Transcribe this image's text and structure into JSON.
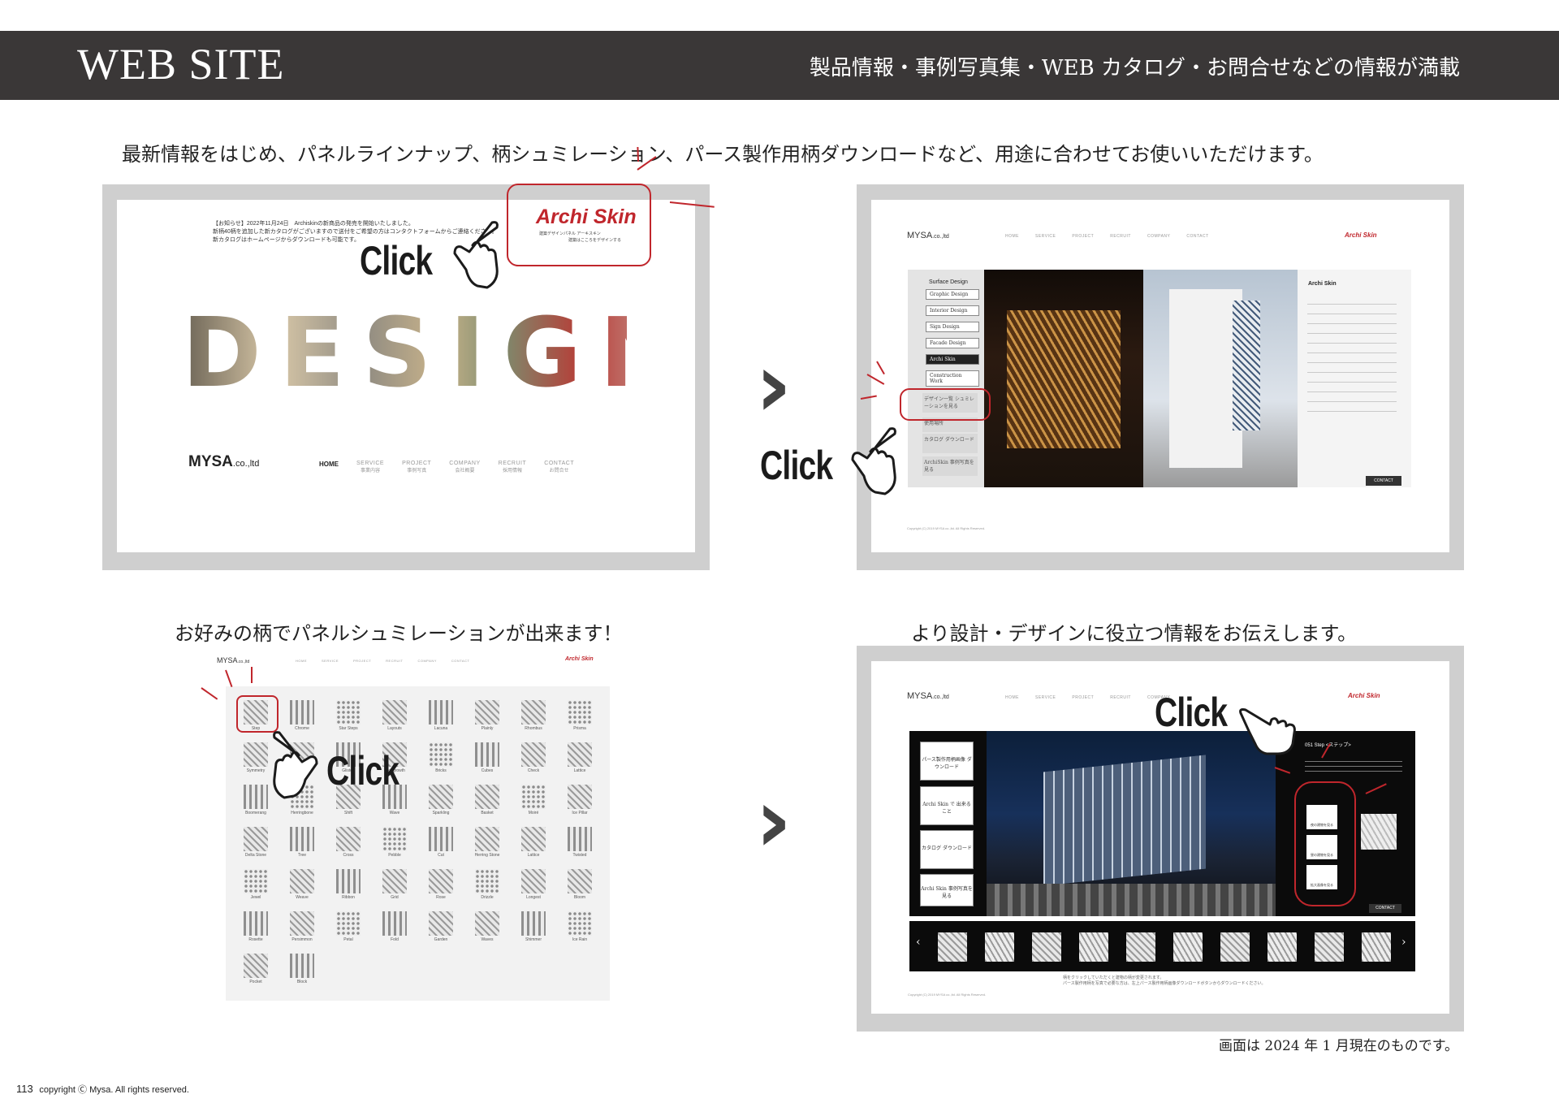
{
  "header": {
    "title": "WEB SITE",
    "subtitle": "製品情報・事例写真集・WEB カタログ・お問合せなどの情報が満載"
  },
  "captions": {
    "top": "最新情報をはじめ、パネルラインナップ、柄シュミレーション、パース製作用柄ダウンロードなど、用途に合わせてお使いいただけます。",
    "bottom_left": "お好みの柄でパネルシュミレーションが出来ます！",
    "bottom_right": "より設計・デザインに役立つ情報をお伝えします。"
  },
  "click_label": "Click",
  "panel1": {
    "news_line1": "【お知らせ】2022年11月24日　Archiskinの新商品の発売を開始いたしました。",
    "news_line2": "新柄40柄を追加した新カタログがございますので送付をご希望の方はコンタクトフォームからご連絡ください。",
    "news_line3": "新カタログはホームページからダウンロードも可能です。",
    "brand_logo": "Archi Skin",
    "brand_sub1": "建築デザインパネル アーキスキン",
    "brand_sub2": "建築はこころをデザインする",
    "hero_word": "DESIGN",
    "company": "MYSA",
    "company_suffix": ".co.,ltd",
    "nav": [
      {
        "label": "HOME",
        "sub": ""
      },
      {
        "label": "SERVICE",
        "sub": "事業内容"
      },
      {
        "label": "PROJECT",
        "sub": "事例写真"
      },
      {
        "label": "COMPANY",
        "sub": "会社概要"
      },
      {
        "label": "RECRUIT",
        "sub": "採用情報"
      },
      {
        "label": "CONTACT",
        "sub": "お問合せ"
      }
    ]
  },
  "panel2": {
    "company": "MYSA",
    "company_suffix": ".co.,ltd",
    "nav": [
      "HOME",
      "SERVICE",
      "PROJECT",
      "RECRUIT",
      "COMPANY",
      "CONTACT"
    ],
    "brand_logo": "Archi Skin",
    "menu_title": "Surface Design",
    "menu": [
      "Graphic Design",
      "Interior Design",
      "Sign Design",
      "Facade Design",
      "Archi Skin",
      "Construction Work"
    ],
    "sub_buttons": [
      "デザイン一覧 シュミレーションを見る",
      "使用場所",
      "カタログ ダウンロード",
      "ArchiSkin 事例写真を見る"
    ],
    "side_title": "Archi Skin",
    "contact_btn": "CONTACT",
    "copyright": "Copyright (C) 2019 MYSA co.,ltd. All Rights Reserved."
  },
  "panel3": {
    "company": "MYSA",
    "company_suffix": ".co.,ltd",
    "nav": [
      "HOME",
      "SERVICE",
      "PROJECT",
      "RECRUIT",
      "COMPANY",
      "CONTACT"
    ],
    "brand_logo": "Archi Skin",
    "tiles": [
      "Step",
      "Chrome",
      "Star Steps",
      "Layouts",
      "Lacuna",
      "Plainly",
      "Rhombus",
      "Prisma",
      "Symmetry",
      "Drops",
      "Glisten",
      "Overgrowth",
      "Bricks",
      "Cubes",
      "Check",
      "Lattice",
      "Boomerang",
      "Herringbone",
      "Shift",
      "Wave",
      "Sparkling",
      "Basket",
      "Moiré",
      "Ice Pillar",
      "Delta Stone",
      "Tree",
      "Cross",
      "Pebble",
      "Cut",
      "Herring Stone",
      "Lattice",
      "Twisted",
      "Jewel",
      "Weave",
      "Ribbon",
      "Grid",
      "Rose",
      "Drizzle",
      "Longest",
      "Bloom",
      "Rosette",
      "Persimmon",
      "Petal",
      "Fold",
      "Garden",
      "Waves",
      "Shimmer",
      "Ice Rain",
      "Pocket",
      "Block"
    ]
  },
  "panel4": {
    "company": "MYSA",
    "company_suffix": ".co.,ltd",
    "nav": [
      "HOME",
      "SERVICE",
      "PROJECT",
      "RECRUIT",
      "COMPANY"
    ],
    "brand_logo": "Archi Skin",
    "left_menu": [
      "パース製作用柄画像 ダウンロード",
      "Archi Skin で 出来ること",
      "カタログ ダウンロード",
      "Archi Skin 事例写真を見る"
    ],
    "pattern_title": "051 Step <ステップ>",
    "view_buttons": [
      "夜の建物を見る",
      "昼の建物を見る",
      "拡大画像を見る"
    ],
    "contact_btn": "CONTACT",
    "footer_text1": "柄をクリックしていただくと建物の柄が変更されます。",
    "footer_text2": "パース製作用柄を写真で必要な方は、左上パース製作用柄画像ダウンロードボタンからダウンロードください。",
    "copyright": "Copyright (C) 2019 MYSA co.,ltd. All Rights Reserved."
  },
  "note": "画面は 2024 年 1 月現在のものです。",
  "footer": {
    "page_number": "113",
    "copyright": "copyright Ⓒ Mysa. All rights reserved."
  },
  "colors": {
    "header_bg": "#3a3737",
    "frame_gray": "#cfcfcf",
    "accent_red": "#c0262c"
  }
}
